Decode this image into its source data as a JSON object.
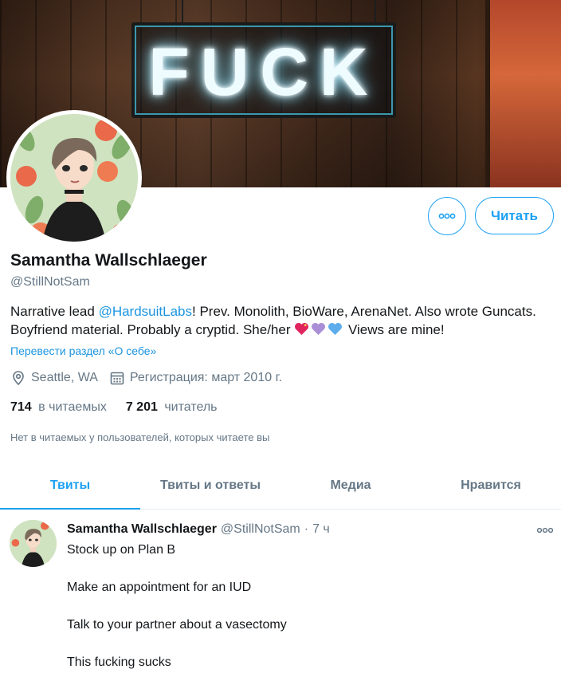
{
  "banner": {
    "neon_sign": "FUCK"
  },
  "profile": {
    "name": "Samantha Wallschlaeger",
    "handle": "@StillNotSam",
    "bio": {
      "part1": "Narrative lead ",
      "mention": "@HardsuitLabs",
      "part2": "! Prev. Monolith, BioWare, ArenaNet. Also wrote Guncats. Boyfriend material. Probably a cryptid. She/her ",
      "part3": " Views are mine!"
    },
    "translate_link": "Перевести раздел «О себе»",
    "location": "Seattle, WA",
    "joined": "Регистрация: март 2010 г.",
    "following_count": "714",
    "following_label": "в читаемых",
    "followers_count": "7 201",
    "followers_label": "читатель",
    "followed_by_note": "Нет в читаемых у пользователей, которых читаете вы"
  },
  "actions": {
    "follow_label": "Читать"
  },
  "tabs": [
    {
      "label": "Твиты",
      "active": true
    },
    {
      "label": "Твиты и ответы",
      "active": false
    },
    {
      "label": "Медиа",
      "active": false
    },
    {
      "label": "Нравится",
      "active": false
    }
  ],
  "tweet": {
    "name": "Samantha Wallschlaeger",
    "handle": "@StillNotSam",
    "separator": "·",
    "time": "7 ч",
    "lines": [
      "Stock up on Plan B",
      "Make an appointment for an IUD",
      "Talk to your partner about a vasectomy",
      "This fucking sucks"
    ]
  },
  "colors": {
    "accent": "#1da1f2",
    "link": "#1b95e0",
    "secondary_text": "#657786",
    "text": "#14171a"
  },
  "icons": [
    "more-horizontal-icon",
    "location-pin-icon",
    "calendar-icon",
    "heart-emoji-icon"
  ]
}
